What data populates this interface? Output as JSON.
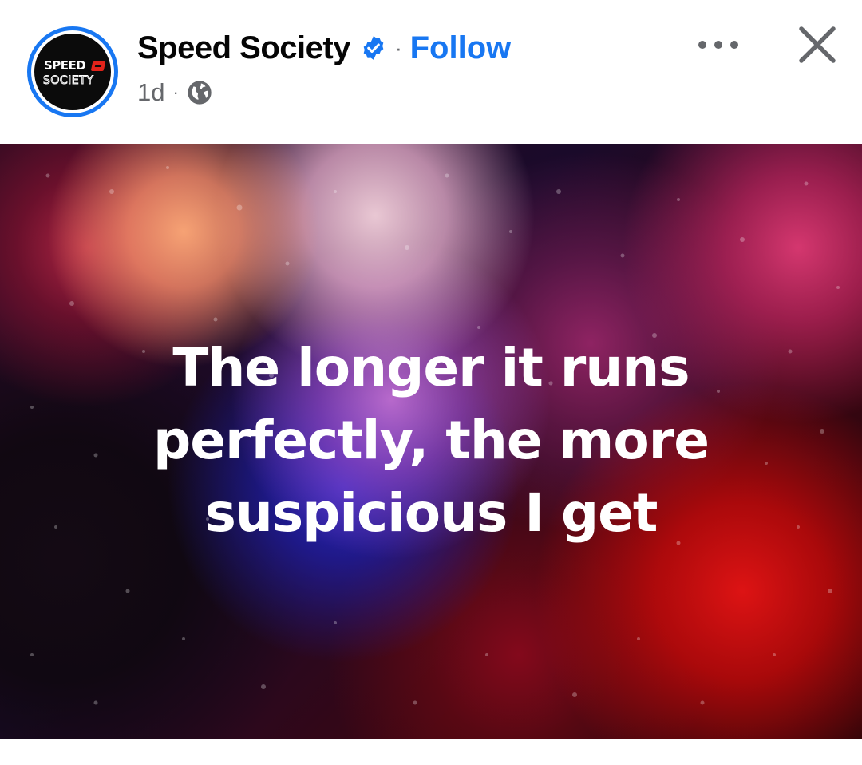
{
  "post": {
    "page_name": "Speed Society",
    "follow_label": "Follow",
    "separator": "·",
    "timestamp": "1d",
    "meta_separator": "·",
    "audience_icon": "globe-icon",
    "verified_icon": "verified-badge-icon",
    "avatar": {
      "logo_line1": "SPEED",
      "logo_line2": "SOCIETY",
      "ring_color": "#1877f2"
    },
    "more_icon": "more-options-icon",
    "close_icon": "close-icon",
    "image_text": [
      "The longer it runs",
      "perfectly, the more",
      "suspicious I get"
    ]
  },
  "colors": {
    "accent": "#1877f2",
    "text_primary": "#050505",
    "text_secondary": "#65676b",
    "logo_red": "#e2231a"
  }
}
